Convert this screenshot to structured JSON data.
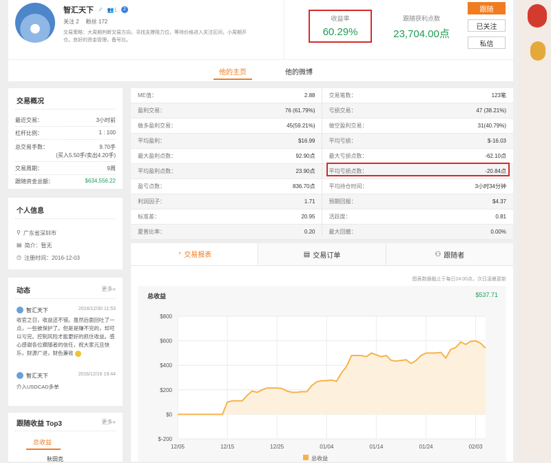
{
  "profile": {
    "name": "智汇天下",
    "gender_symbol": "♂",
    "badge_text": "1",
    "follow_label": "关注 2",
    "fans_label": "粉丝 172",
    "strategy_line1": "交易策略：大周期判断交易方向，寻找支撑阻力位，等待价格进入关注区间，小周期开",
    "strategy_line2": "仓。良好的资金管理，备号比。"
  },
  "stats": {
    "yield_label": "收益率",
    "yield_value": "60.29%",
    "follow_points_label": "跟随获利点数",
    "follow_points_value": "23,704.00点"
  },
  "actions": {
    "follow_btn": "跟随",
    "followed_btn": "已关注",
    "message_btn": "私信"
  },
  "tabs": {
    "home": "他的主页",
    "weibo": "他的微博"
  },
  "overview": {
    "title": "交易概况",
    "rows": [
      {
        "label": "最近交易：",
        "value": "3小时前"
      },
      {
        "label": "杠杆比例：",
        "value": "1 : 100"
      },
      {
        "label": "总交易手数：",
        "value": "9.70手"
      },
      {
        "label": "",
        "value": "(买入5.50手/卖出4.20手)"
      },
      {
        "label": "交易周期：",
        "value": "9周"
      },
      {
        "label": "跟随资金总额：",
        "value": "$634,556.22"
      }
    ]
  },
  "personal": {
    "title": "个人信息",
    "location": "广东省深圳市",
    "intro": "简介：暂无",
    "register": "注册时间：2016-12-03"
  },
  "dynamic": {
    "title": "动态",
    "more": "更多»",
    "posts": [
      {
        "author": "智汇天下",
        "time": "2016/12/30 11:53",
        "line1": "收官之日，收益还不错。虽然后面回吐了一",
        "line2": "点，一些被保护了。但是是赚不完的，却可",
        "line3": "以亏完。控制风险才能更好的抓住收益。感",
        "line4": "心感谢各位跟随者的信任，祝大家元旦快",
        "line5": "乐，财源广进，财色兼收"
      },
      {
        "author": "智汇天下",
        "time": "2016/12/16 19:44",
        "line1": "介入USDCAD多单"
      }
    ]
  },
  "top3": {
    "title": "跟随收益 Top3",
    "more": "更多»",
    "tab": "总收益",
    "partial": "秋田克"
  },
  "metrics": {
    "left": [
      {
        "label": "ME值：",
        "value": "2.88"
      },
      {
        "label": "盈利交易：",
        "value": "76 (61.79%)"
      },
      {
        "label": "做多盈利交易：",
        "value": "45(59.21%)"
      },
      {
        "label": "平均盈利：",
        "value": "$16.99"
      },
      {
        "label": "最大盈利点数：",
        "value": "92.90点"
      },
      {
        "label": "平均盈利点数：",
        "value": "23.90点"
      },
      {
        "label": "盈亏点数：",
        "value": "836.70点"
      },
      {
        "label": "利润因子：",
        "value": "1.71"
      },
      {
        "label": "标准差：",
        "value": "20.95"
      },
      {
        "label": "夏普比率：",
        "value": "0.20"
      }
    ],
    "right": [
      {
        "label": "交易笔数：",
        "value": "123笔"
      },
      {
        "label": "亏损交易：",
        "value": "47 (38.21%)"
      },
      {
        "label": "做空盈利交易：",
        "value": "31(40.79%)"
      },
      {
        "label": "平均亏损：",
        "value": "$-16.03"
      },
      {
        "label": "最大亏损点数：",
        "value": "-62.10点"
      },
      {
        "label": "平均亏损点数：",
        "value": "-20.84点"
      },
      {
        "label": "平均持仓时间：",
        "value": "3小时34分钟"
      },
      {
        "label": "预期回报：",
        "value": "$4.37"
      },
      {
        "label": "活跃度：",
        "value": "0.81"
      },
      {
        "label": "最大回撤：",
        "value": "0.00%"
      }
    ]
  },
  "chart_tabs": {
    "report": "交易报表",
    "orders": "交易订单",
    "followers": "跟随者"
  },
  "chart_note": "图表数据截止于每日24:00点，次日凌晨更新",
  "chart_title": "总收益",
  "chart_total": "$537.71",
  "colors": {
    "accent": "#f07c21",
    "line": "#f6b24a",
    "fill": "#fdf1de",
    "highlight": "#d42a2a"
  },
  "chart_data": {
    "type": "area",
    "title": "总收益",
    "xlabel": "",
    "ylabel": "",
    "ylim": [
      -200,
      800
    ],
    "yticks": [
      "$800",
      "$600",
      "$400",
      "$200",
      "$0",
      "$-200"
    ],
    "ytick_values": [
      800,
      600,
      400,
      200,
      0,
      -200
    ],
    "xticks": [
      "12/05",
      "12/15",
      "12/25",
      "01/04",
      "01/14",
      "01/24",
      "02/03"
    ],
    "xtick_values": [
      0,
      10,
      20,
      30,
      40,
      50,
      60
    ],
    "x_range": [
      0,
      62
    ],
    "grid": true,
    "legend": "bottom",
    "series": [
      {
        "name": "总收益",
        "x": [
          0,
          2,
          4,
          6,
          8,
          9,
          10,
          11,
          12,
          13,
          14,
          15,
          16,
          17,
          18,
          19,
          20,
          21,
          22,
          23,
          24,
          25,
          26,
          27,
          28,
          29,
          30,
          31,
          32,
          33,
          34,
          35,
          36,
          37,
          38,
          39,
          40,
          41,
          42,
          43,
          44,
          45,
          46,
          47,
          48,
          49,
          50,
          51,
          52,
          53,
          54,
          55,
          56,
          57,
          58,
          59,
          60,
          61,
          62
        ],
        "y": [
          0,
          0,
          0,
          0,
          0,
          0,
          100,
          110,
          110,
          110,
          155,
          190,
          180,
          200,
          215,
          215,
          215,
          210,
          190,
          180,
          180,
          185,
          185,
          235,
          265,
          275,
          275,
          280,
          270,
          340,
          390,
          480,
          480,
          480,
          470,
          500,
          485,
          470,
          480,
          440,
          435,
          440,
          445,
          415,
          440,
          480,
          500,
          500,
          500,
          505,
          460,
          530,
          545,
          590,
          570,
          595,
          600,
          580,
          540
        ]
      }
    ]
  }
}
